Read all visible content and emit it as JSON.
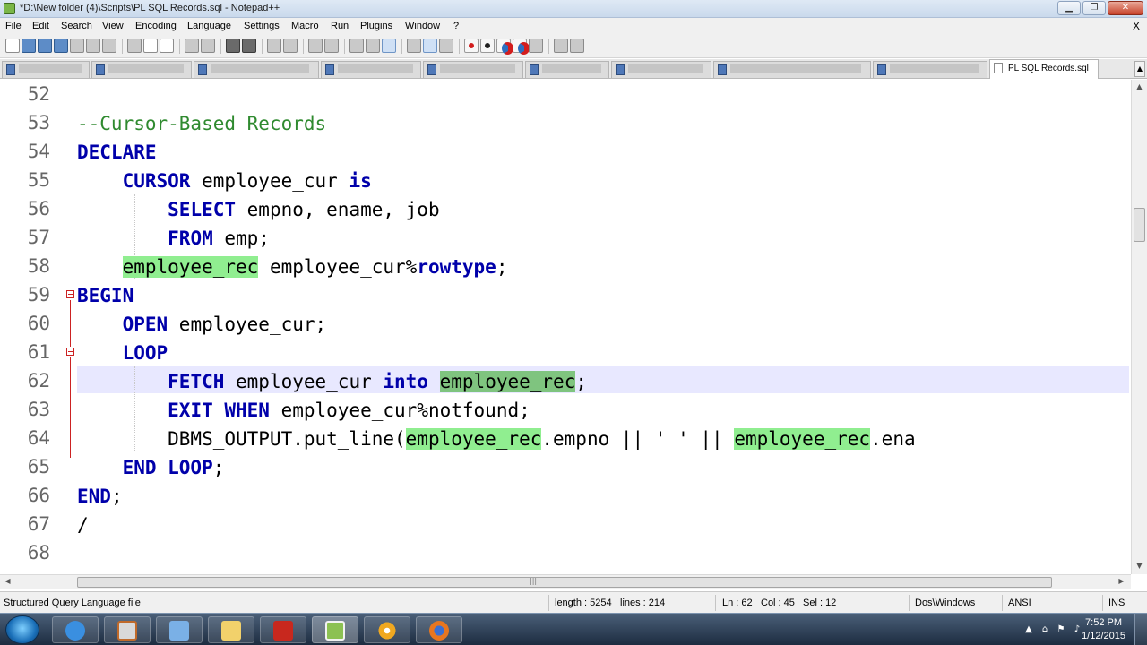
{
  "window": {
    "title": "*D:\\New folder (4)\\Scripts\\PL SQL Records.sql - Notepad++",
    "minimize": "▁",
    "maximize": "❐",
    "close": "✕"
  },
  "menu": {
    "items": [
      "File",
      "Edit",
      "Search",
      "View",
      "Encoding",
      "Language",
      "Settings",
      "Macro",
      "Run",
      "Plugins",
      "Window",
      "?"
    ],
    "close_doc": "X"
  },
  "tabs": {
    "active_label": "PL SQL Records.sql"
  },
  "editor": {
    "line_numbers": [
      "52",
      "53",
      "54",
      "55",
      "56",
      "57",
      "58",
      "59",
      "60",
      "61",
      "62",
      "63",
      "64",
      "65",
      "66",
      "67",
      "68"
    ],
    "lines": [
      {
        "n": "52",
        "parts": []
      },
      {
        "n": "53",
        "parts": [
          {
            "t": "--Cursor-Based Records",
            "c": "cm"
          }
        ]
      },
      {
        "n": "54",
        "parts": [
          {
            "t": "DECLARE",
            "c": "kw"
          }
        ]
      },
      {
        "n": "55",
        "parts": [
          {
            "t": "    "
          },
          {
            "t": "CURSOR",
            "c": "kw"
          },
          {
            "t": " employee_cur "
          },
          {
            "t": "is",
            "c": "kw"
          }
        ]
      },
      {
        "n": "56",
        "parts": [
          {
            "t": "        "
          },
          {
            "t": "SELECT",
            "c": "kw"
          },
          {
            "t": " empno, ename, job"
          }
        ]
      },
      {
        "n": "57",
        "parts": [
          {
            "t": "        "
          },
          {
            "t": "FROM",
            "c": "kw"
          },
          {
            "t": " emp;"
          }
        ]
      },
      {
        "n": "58",
        "parts": [
          {
            "t": "    "
          },
          {
            "t": "employee_rec",
            "c": "hl"
          },
          {
            "t": " employee_cur%"
          },
          {
            "t": "rowtype",
            "c": "kw"
          },
          {
            "t": ";"
          }
        ]
      },
      {
        "n": "59",
        "parts": [
          {
            "t": "BEGIN",
            "c": "kw"
          }
        ]
      },
      {
        "n": "60",
        "parts": [
          {
            "t": "    "
          },
          {
            "t": "OPEN",
            "c": "kw"
          },
          {
            "t": " employee_cur;"
          }
        ]
      },
      {
        "n": "61",
        "parts": [
          {
            "t": "    "
          },
          {
            "t": "LOOP",
            "c": "kw"
          }
        ]
      },
      {
        "n": "62",
        "parts": [
          {
            "t": "        "
          },
          {
            "t": "FETCH",
            "c": "kw"
          },
          {
            "t": " employee_cur "
          },
          {
            "t": "into",
            "c": "kw"
          },
          {
            "t": " "
          },
          {
            "t": "employee_rec",
            "c": "sel"
          },
          {
            "t": ";"
          }
        ]
      },
      {
        "n": "63",
        "parts": [
          {
            "t": "        "
          },
          {
            "t": "EXIT WHEN",
            "c": "kw"
          },
          {
            "t": " employee_cur%notfound;"
          }
        ]
      },
      {
        "n": "64",
        "parts": [
          {
            "t": "        DBMS_OUTPUT.put_line("
          },
          {
            "t": "employee_rec",
            "c": "hl"
          },
          {
            "t": ".empno || ' ' || "
          },
          {
            "t": "employee_rec",
            "c": "hl"
          },
          {
            "t": ".ena"
          }
        ]
      },
      {
        "n": "65",
        "parts": [
          {
            "t": "    "
          },
          {
            "t": "END LOOP",
            "c": "kw"
          },
          {
            "t": ";"
          }
        ]
      },
      {
        "n": "66",
        "parts": [
          {
            "t": "END",
            "c": "kw"
          },
          {
            "t": ";"
          }
        ]
      },
      {
        "n": "67",
        "parts": [
          {
            "t": "/"
          }
        ]
      },
      {
        "n": "68",
        "parts": []
      }
    ]
  },
  "scroll": {
    "hscroll_grip": "|||"
  },
  "status": {
    "file_type": "Structured Query Language file",
    "length": "length : 5254",
    "lines": "lines : 214",
    "ln": "Ln : 62",
    "col": "Col : 45",
    "sel": "Sel : 12",
    "eol": "Dos\\Windows",
    "encoding": "ANSI",
    "mode": "INS"
  },
  "taskbar": {
    "time": "7:52 PM",
    "date": "1/12/2015",
    "apps": [
      "internet-explorer",
      "media-player",
      "file-explorer",
      "folder",
      "pdf-reader",
      "notepad-plus-plus",
      "plugin-app",
      "firefox"
    ]
  },
  "colors": {
    "keyword": "#0000aa",
    "comment": "#2f8a2f",
    "match_highlight": "#90ee90",
    "current_line": "#e8e8ff"
  }
}
